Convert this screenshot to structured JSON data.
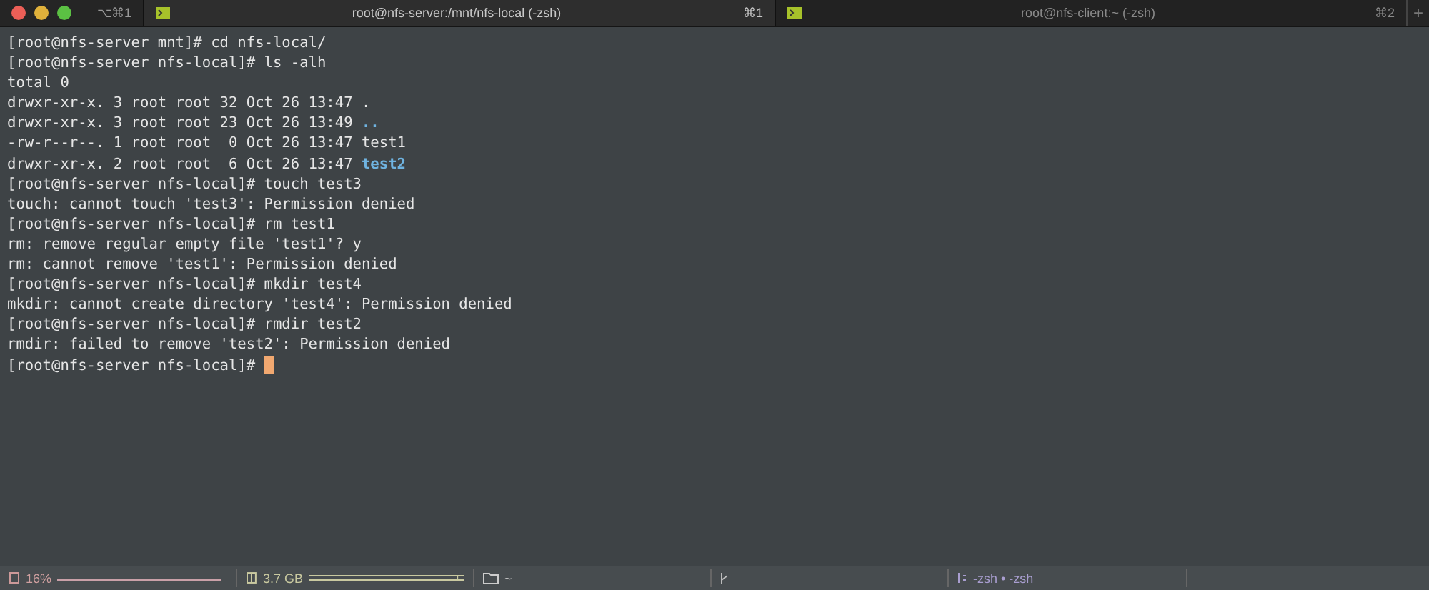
{
  "window": {
    "shortcut": "⌥⌘1"
  },
  "tabs": [
    {
      "title": "root@nfs-server:/mnt/nfs-local (-zsh)",
      "shortcut": "⌘1",
      "selected": true
    },
    {
      "title": "root@nfs-client:~ (-zsh)",
      "shortcut": "⌘2",
      "selected": false
    }
  ],
  "new_tab": "+",
  "terminal": {
    "cursor_visible": true,
    "lines": [
      {
        "text": "[root@nfs-server mnt]# cd nfs-local/"
      },
      {
        "text": "[root@nfs-server nfs-local]# ls -alh"
      },
      {
        "text": "total 0"
      },
      {
        "text": "drwxr-xr-x. 3 root root 32 Oct 26 13:47 ."
      },
      {
        "text": "drwxr-xr-x. 3 root root 23 Oct 26 13:49 ",
        "dir": ".."
      },
      {
        "text": "-rw-r--r--. 1 root root  0 Oct 26 13:47 test1"
      },
      {
        "text": "drwxr-xr-x. 2 root root  6 Oct 26 13:47 ",
        "dir": "test2"
      },
      {
        "text": "[root@nfs-server nfs-local]# touch test3"
      },
      {
        "text": "touch: cannot touch 'test3': Permission denied"
      },
      {
        "text": "[root@nfs-server nfs-local]# rm test1"
      },
      {
        "text": "rm: remove regular empty file 'test1'? y"
      },
      {
        "text": "rm: cannot remove 'test1': Permission denied"
      },
      {
        "text": "[root@nfs-server nfs-local]# mkdir test4"
      },
      {
        "text": "mkdir: cannot create directory 'test4': Permission denied"
      },
      {
        "text": "[root@nfs-server nfs-local]# rmdir test2"
      },
      {
        "text": "rmdir: failed to remove 'test2': Permission denied"
      },
      {
        "text": "[root@nfs-server nfs-local]# "
      }
    ]
  },
  "status_bar": {
    "cpu": "16%",
    "memory": "3.7 GB",
    "directory": "~",
    "jobs": "-zsh • -zsh"
  }
}
